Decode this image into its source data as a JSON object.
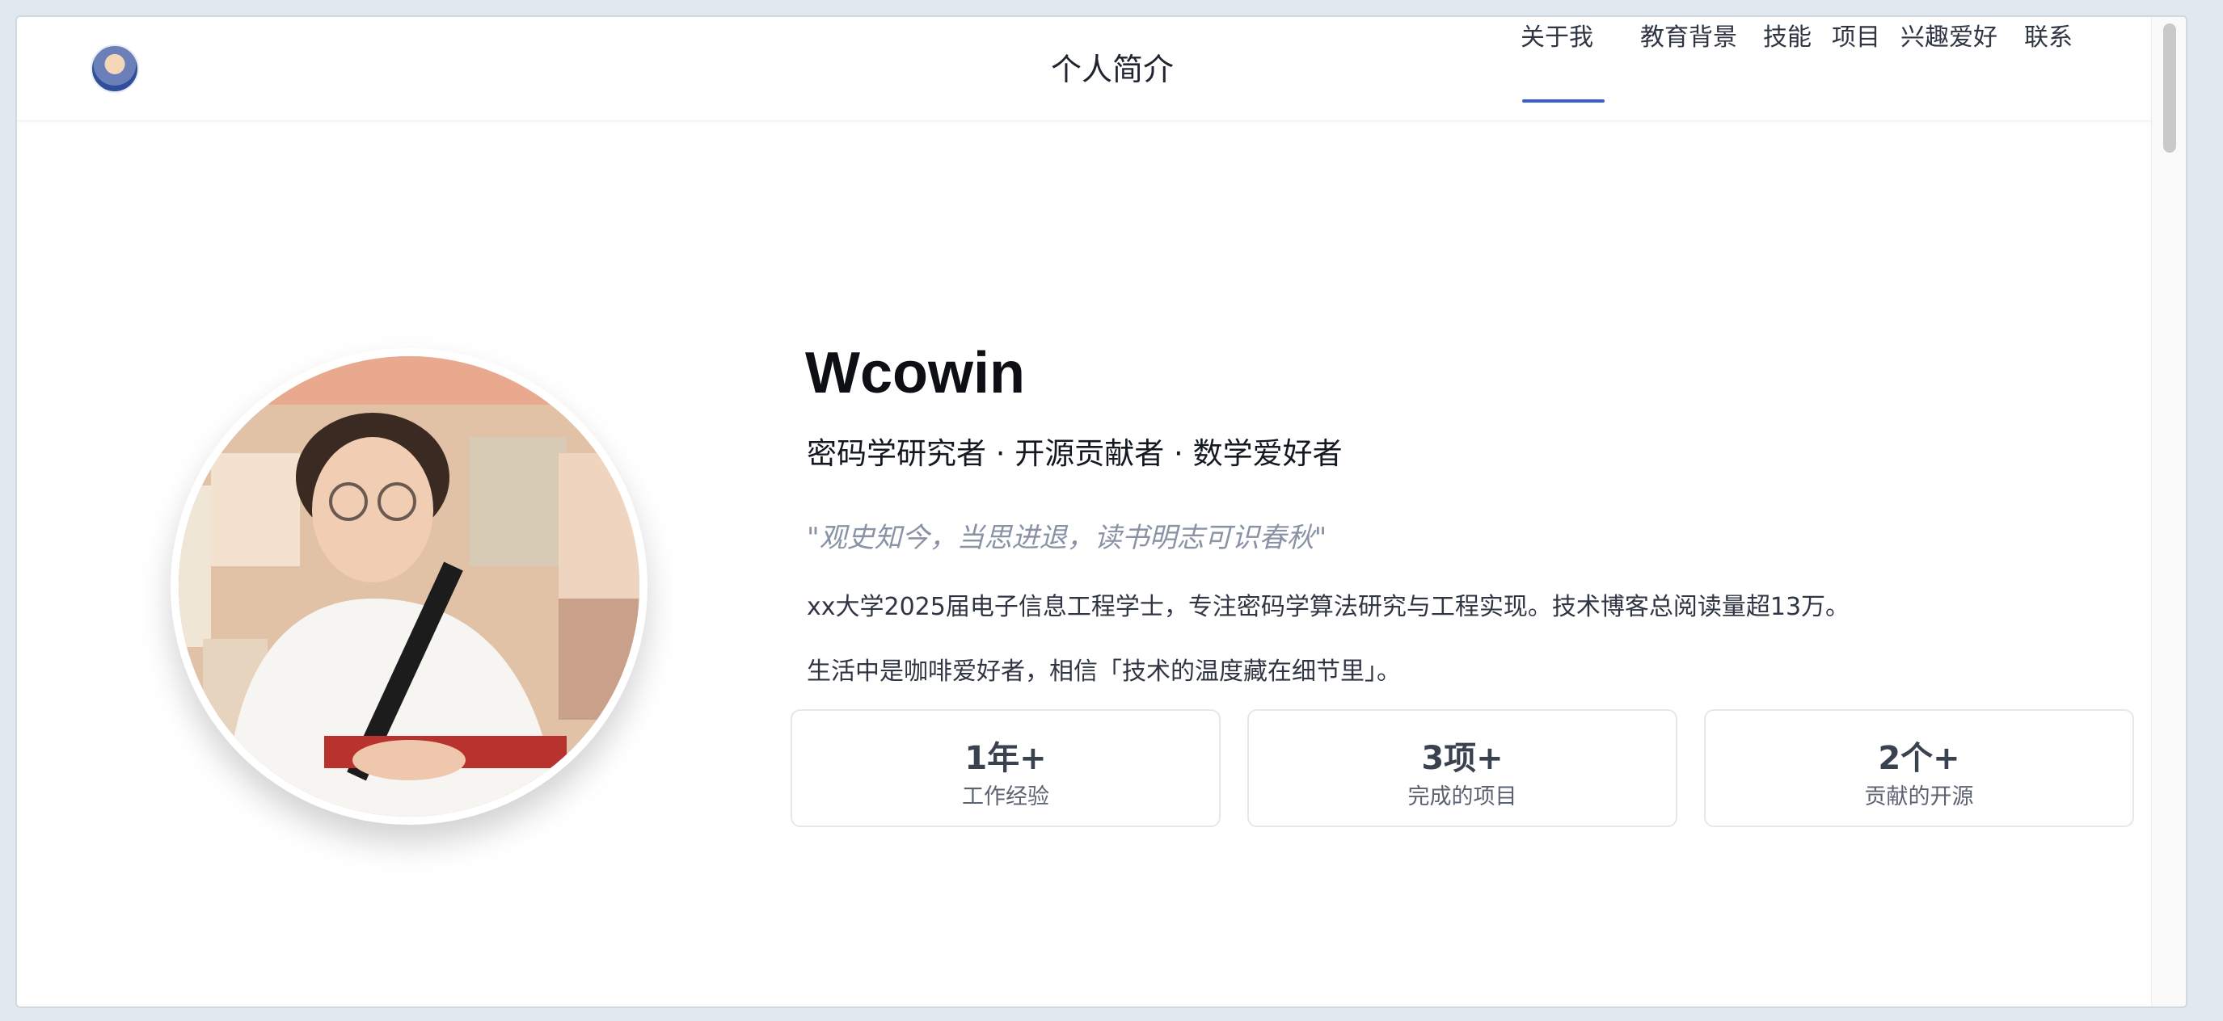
{
  "header": {
    "title": "个人简介",
    "nav": [
      {
        "label": "关于我",
        "active": true
      },
      {
        "label": "教育背景",
        "active": false
      },
      {
        "label": "技能",
        "active": false
      },
      {
        "label": "项目",
        "active": false
      },
      {
        "label": "兴趣爱好",
        "active": false
      },
      {
        "label": "联系",
        "active": false
      }
    ],
    "accent_color": "#3a5ecf"
  },
  "profile": {
    "name": "Wcowin",
    "tagline": "密码学研究者 · 开源贡献者 · 数学爱好者",
    "quote": "\"观史知今，当思进退，读书明志可识春秋\"",
    "bio_1": "xx大学2025届电子信息工程学士，专注密码学算法研究与工程实现。技术博客总阅读量超13万。",
    "bio_2": "生活中是咖啡爱好者，相信「技术的温度藏在细节里」。"
  },
  "stats": [
    {
      "value": "1年+",
      "label": "工作经验"
    },
    {
      "value": "3项+",
      "label": "完成的项目"
    },
    {
      "value": "2个+",
      "label": "贡献的开源"
    }
  ]
}
